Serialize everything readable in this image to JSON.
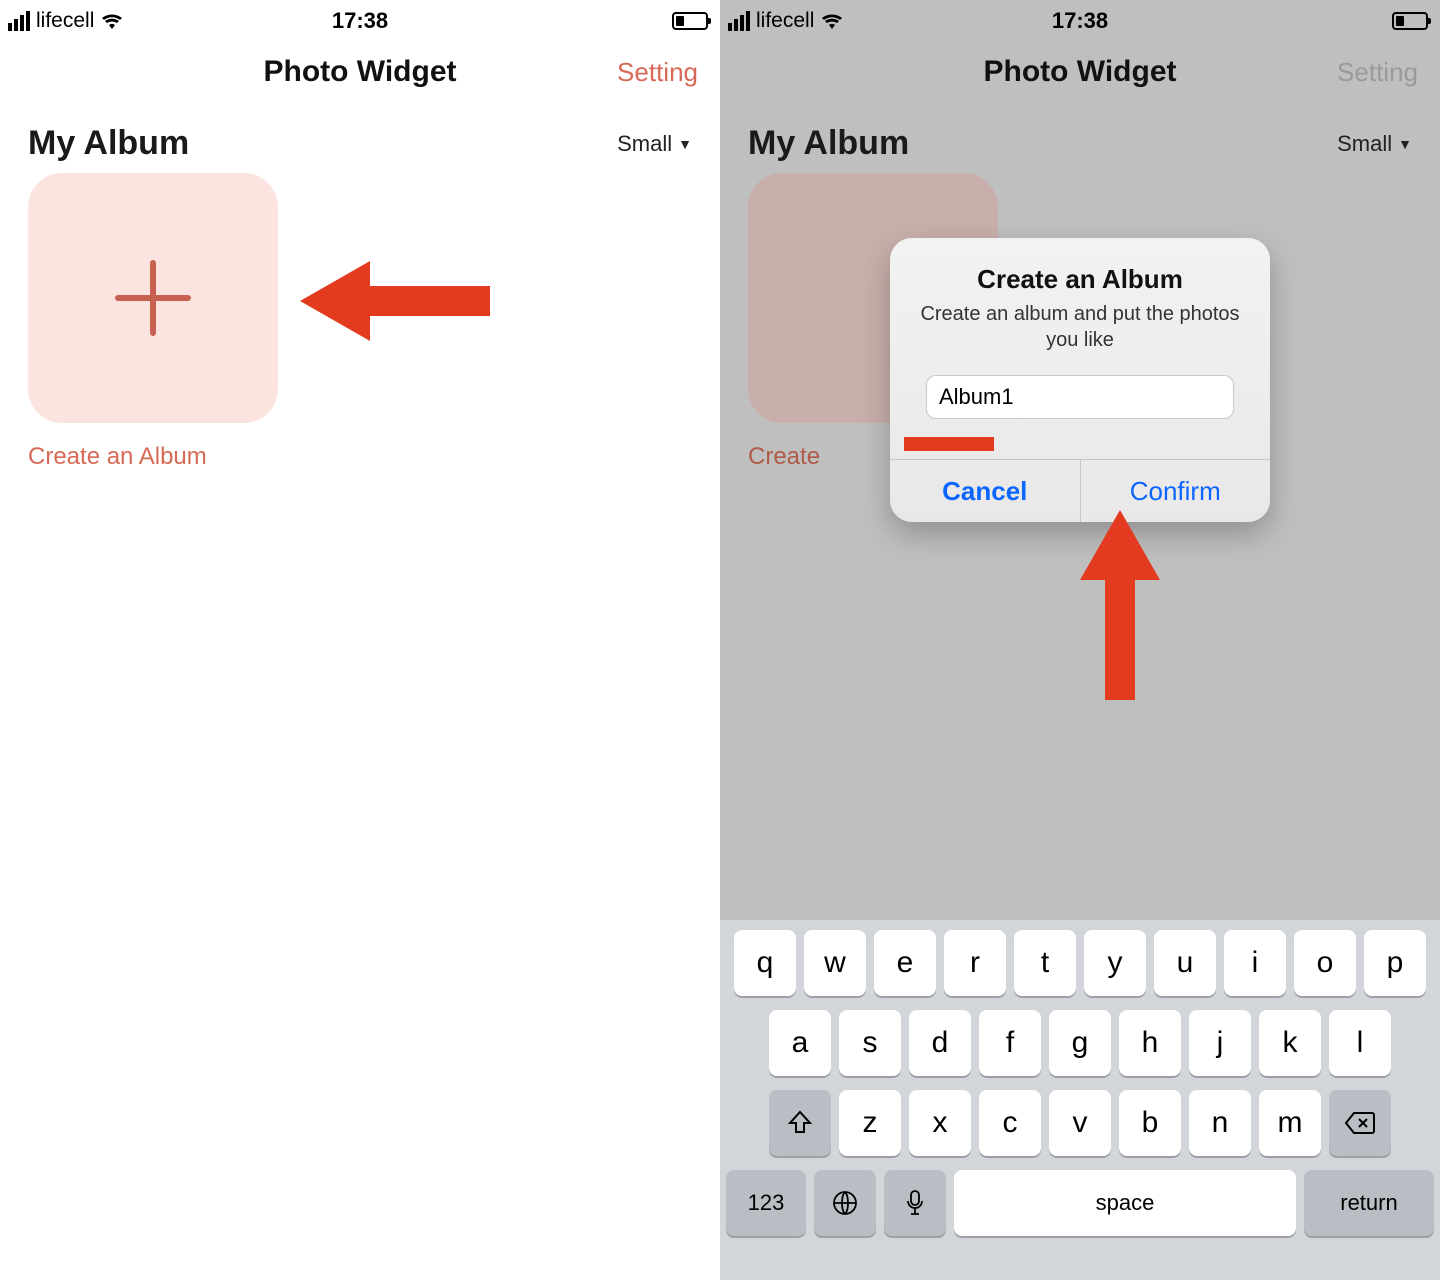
{
  "status": {
    "carrier": "lifecell",
    "time": "17:38"
  },
  "nav": {
    "title": "Photo Widget",
    "setting": "Setting"
  },
  "section": {
    "title": "My Album",
    "size": "Small"
  },
  "tile": {
    "caption_left": "Create an Album",
    "caption_right": "Create"
  },
  "alert": {
    "title": "Create an Album",
    "message": "Create an album and put the photos you like",
    "input_value": "Album1",
    "cancel": "Cancel",
    "confirm": "Confirm"
  },
  "keyboard": {
    "row1": [
      "q",
      "w",
      "e",
      "r",
      "t",
      "y",
      "u",
      "i",
      "o",
      "p"
    ],
    "row2": [
      "a",
      "s",
      "d",
      "f",
      "g",
      "h",
      "j",
      "k",
      "l"
    ],
    "row3": [
      "z",
      "x",
      "c",
      "v",
      "b",
      "n",
      "m"
    ],
    "num": "123",
    "space": "space",
    "ret": "return"
  }
}
